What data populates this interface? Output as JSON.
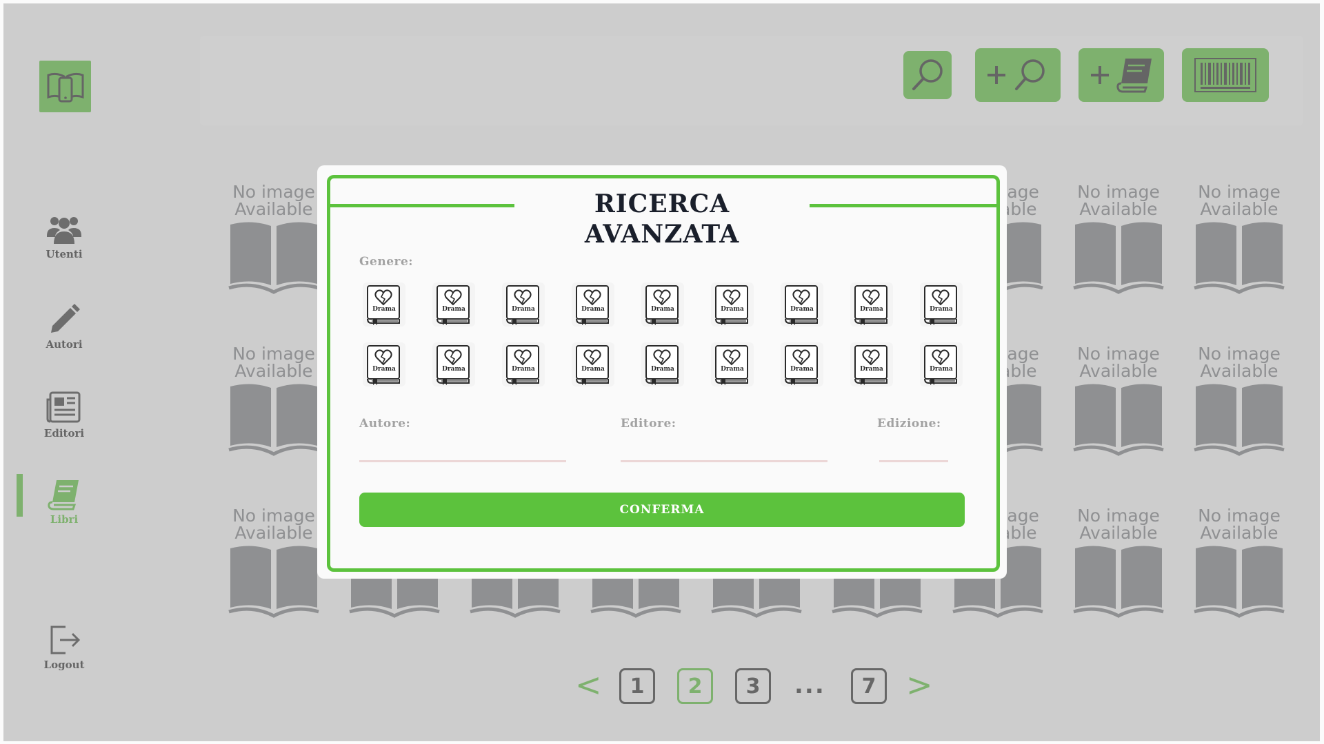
{
  "sidebar": {
    "items": [
      {
        "label": "Utenti",
        "icon": "users-icon"
      },
      {
        "label": "Autori",
        "icon": "pencil-icon"
      },
      {
        "label": "Editori",
        "icon": "newspaper-icon"
      },
      {
        "label": "Libri",
        "icon": "book-icon",
        "active": true
      }
    ],
    "logout_label": "Logout"
  },
  "toolbar": {
    "buttons": [
      {
        "icon": "search-icon",
        "plus": false
      },
      {
        "icon": "search-icon",
        "plus": true
      },
      {
        "icon": "book-icon",
        "plus": true
      },
      {
        "icon": "barcode-icon",
        "plus": false
      }
    ]
  },
  "books": {
    "placeholder_line1": "No image",
    "placeholder_line2": "Available",
    "count": 27
  },
  "pagination": {
    "prev": "<",
    "next": ">",
    "pages": [
      "1",
      "2",
      "3"
    ],
    "active_page": "2",
    "ellipsis": "...",
    "last_page": "7"
  },
  "modal": {
    "title": "RICERCA AVANZATA",
    "genre_label": "Genere:",
    "genres": [
      "Drama",
      "Drama",
      "Drama",
      "Drama",
      "Drama",
      "Drama",
      "Drama",
      "Drama",
      "Drama",
      "Drama",
      "Drama",
      "Drama",
      "Drama",
      "Drama",
      "Drama",
      "Drama",
      "Drama",
      "Drama"
    ],
    "author_label": "Autore:",
    "author_value": "",
    "publisher_label": "Editore:",
    "publisher_value": "",
    "edition_label": "Edizione:",
    "edition_value": "",
    "confirm_label": "CONFERMA"
  },
  "colors": {
    "accent": "#5cc23d",
    "title": "#1a1f2b",
    "label": "#a2a2a2"
  }
}
